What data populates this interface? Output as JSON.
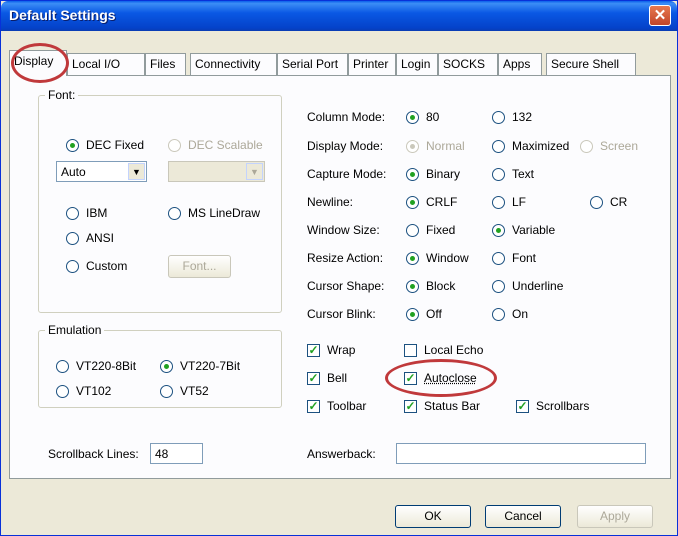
{
  "window": {
    "title": "Default Settings",
    "close": "✕"
  },
  "tabs": [
    "Display",
    "Local I/O",
    "Files",
    "Connectivity",
    "Serial Port",
    "Printer",
    "Login",
    "SOCKS",
    "Apps",
    "Secure Shell"
  ],
  "font_group": {
    "label": "Font:",
    "dec_fixed": "DEC Fixed",
    "dec_scalable": "DEC Scalable",
    "size_value": "Auto",
    "scalable_value": "",
    "ibm": "IBM",
    "ms_linedraw": "MS LineDraw",
    "ansi": "ANSI",
    "custom": "Custom",
    "font_button": "Font..."
  },
  "emulation_group": {
    "label": "Emulation",
    "vt220_8bit": "VT220-8Bit",
    "vt220_7bit": "VT220-7Bit",
    "vt102": "VT102",
    "vt52": "VT52"
  },
  "settings": {
    "column_mode": {
      "label": "Column Mode:",
      "opt1": "80",
      "opt2": "132"
    },
    "display_mode": {
      "label": "Display Mode:",
      "opt1": "Normal",
      "opt2": "Maximized",
      "opt3": "Screen"
    },
    "capture_mode": {
      "label": "Capture Mode:",
      "opt1": "Binary",
      "opt2": "Text"
    },
    "newline": {
      "label": "Newline:",
      "opt1": "CRLF",
      "opt2": "LF",
      "opt3": "CR"
    },
    "window_size": {
      "label": "Window Size:",
      "opt1": "Fixed",
      "opt2": "Variable"
    },
    "resize_action": {
      "label": "Resize Action:",
      "opt1": "Window",
      "opt2": "Font"
    },
    "cursor_shape": {
      "label": "Cursor Shape:",
      "opt1": "Block",
      "opt2": "Underline"
    },
    "cursor_blink": {
      "label": "Cursor Blink:",
      "opt1": "Off",
      "opt2": "On"
    }
  },
  "checkboxes": {
    "wrap": "Wrap",
    "local_echo": "Local Echo",
    "bell": "Bell",
    "autoclose": "Autoclose",
    "toolbar": "Toolbar",
    "status_bar": "Status Bar",
    "scrollbars": "Scrollbars"
  },
  "scrollback": {
    "label": "Scrollback Lines:",
    "value": "48"
  },
  "answerback": {
    "label": "Answerback:",
    "value": ""
  },
  "buttons": {
    "ok": "OK",
    "cancel": "Cancel",
    "apply": "Apply"
  },
  "colors": {
    "title_bar": "#0a58e4",
    "highlight_circle": "#c0393b",
    "selected_dot": "#21a121"
  }
}
